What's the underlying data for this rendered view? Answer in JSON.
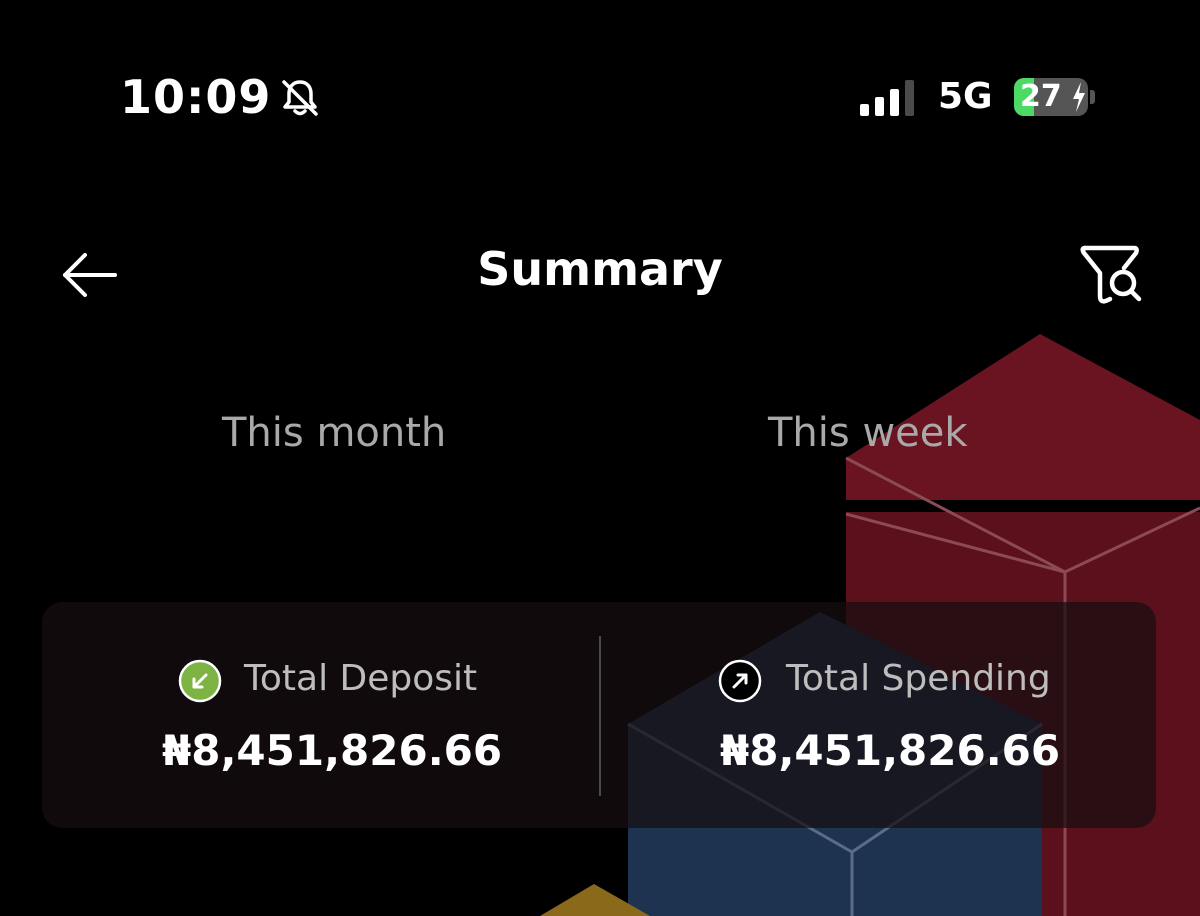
{
  "status_bar": {
    "time": "10:09",
    "network": "5G",
    "battery_level": "27",
    "battery_fraction": 0.27,
    "silent_icon": "bell-slash-icon",
    "signal_icon": "cellular-signal-icon"
  },
  "header": {
    "title": "Summary",
    "back_icon": "arrow-left-icon",
    "filter_icon": "filter-search-icon"
  },
  "tabs": [
    {
      "label": "This month"
    },
    {
      "label": "This week"
    }
  ],
  "summary": {
    "deposit": {
      "label": "Total Deposit",
      "amount": "₦8,451,826.66",
      "icon": "arrow-down-left-icon",
      "icon_color": "#7cb342"
    },
    "spending": {
      "label": "Total Spending",
      "amount": "₦8,451,826.66",
      "icon": "arrow-up-right-icon",
      "icon_color": "#000000"
    }
  },
  "colors": {
    "background": "#000000",
    "text_primary": "#ffffff",
    "text_secondary": "#a9a9a9",
    "battery_green": "#4cd964"
  }
}
